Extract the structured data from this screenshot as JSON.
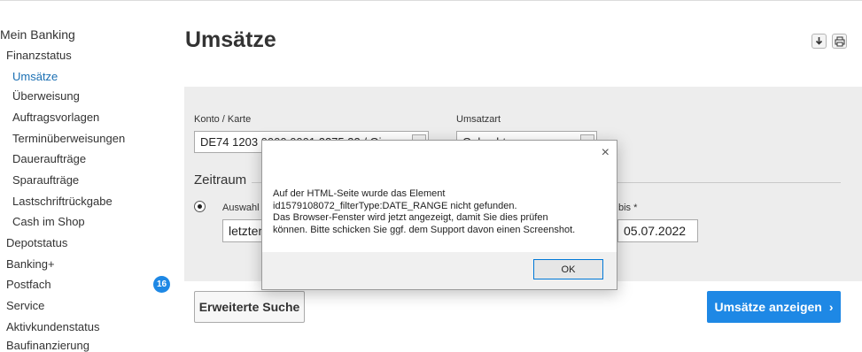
{
  "sidebar": {
    "title": "Mein Banking",
    "items": [
      {
        "label": "Finanzstatus"
      },
      {
        "label": "Umsätze"
      },
      {
        "label": "Überweisung"
      },
      {
        "label": "Auftragsvorlagen"
      },
      {
        "label": "Terminüberweisungen"
      },
      {
        "label": "Daueraufträge"
      },
      {
        "label": "Sparaufträge"
      },
      {
        "label": "Lastschriftrückgabe"
      },
      {
        "label": "Cash im Shop"
      },
      {
        "label": "Depotstatus"
      },
      {
        "label": "Banking+"
      },
      {
        "label": "Postfach",
        "badge": "16"
      },
      {
        "label": "Service"
      },
      {
        "label": "Aktivkundenstatus"
      },
      {
        "label": "Baufinanzierung"
      }
    ]
  },
  "page": {
    "title": "Umsätze",
    "tools": [
      {
        "icon": "download-icon"
      },
      {
        "icon": "print-icon"
      }
    ]
  },
  "form": {
    "account_label": "Konto / Karte",
    "account_value": "DE74 1203 0000 0001 2375 33 / Gi",
    "type_label": "Umsatzart",
    "type_value": "Gebucht",
    "period_title": "Zeitraum",
    "selection_label": "Auswahl",
    "selection_value": "letzten",
    "to_label": "bis *",
    "to_value": "05.07.2022"
  },
  "actions": {
    "advanced_search": "Erweiterte Suche",
    "show_transactions": "Umsätze anzeigen",
    "show_arrow": "›"
  },
  "dialog": {
    "close": "×",
    "lines": [
      "Auf der HTML-Seite wurde das Element",
      "id1579108072_filterType:DATE_RANGE nicht gefunden.",
      "Das Browser-Fenster wird jetzt angezeigt, damit Sie dies prüfen",
      "können. Bitte schicken Sie ggf. dem Support davon einen Screenshot."
    ],
    "ok_label": "OK"
  },
  "colors": {
    "accent": "#1e88e5",
    "active_nav": "#1a6fb3",
    "panel_bg": "#ededed"
  }
}
